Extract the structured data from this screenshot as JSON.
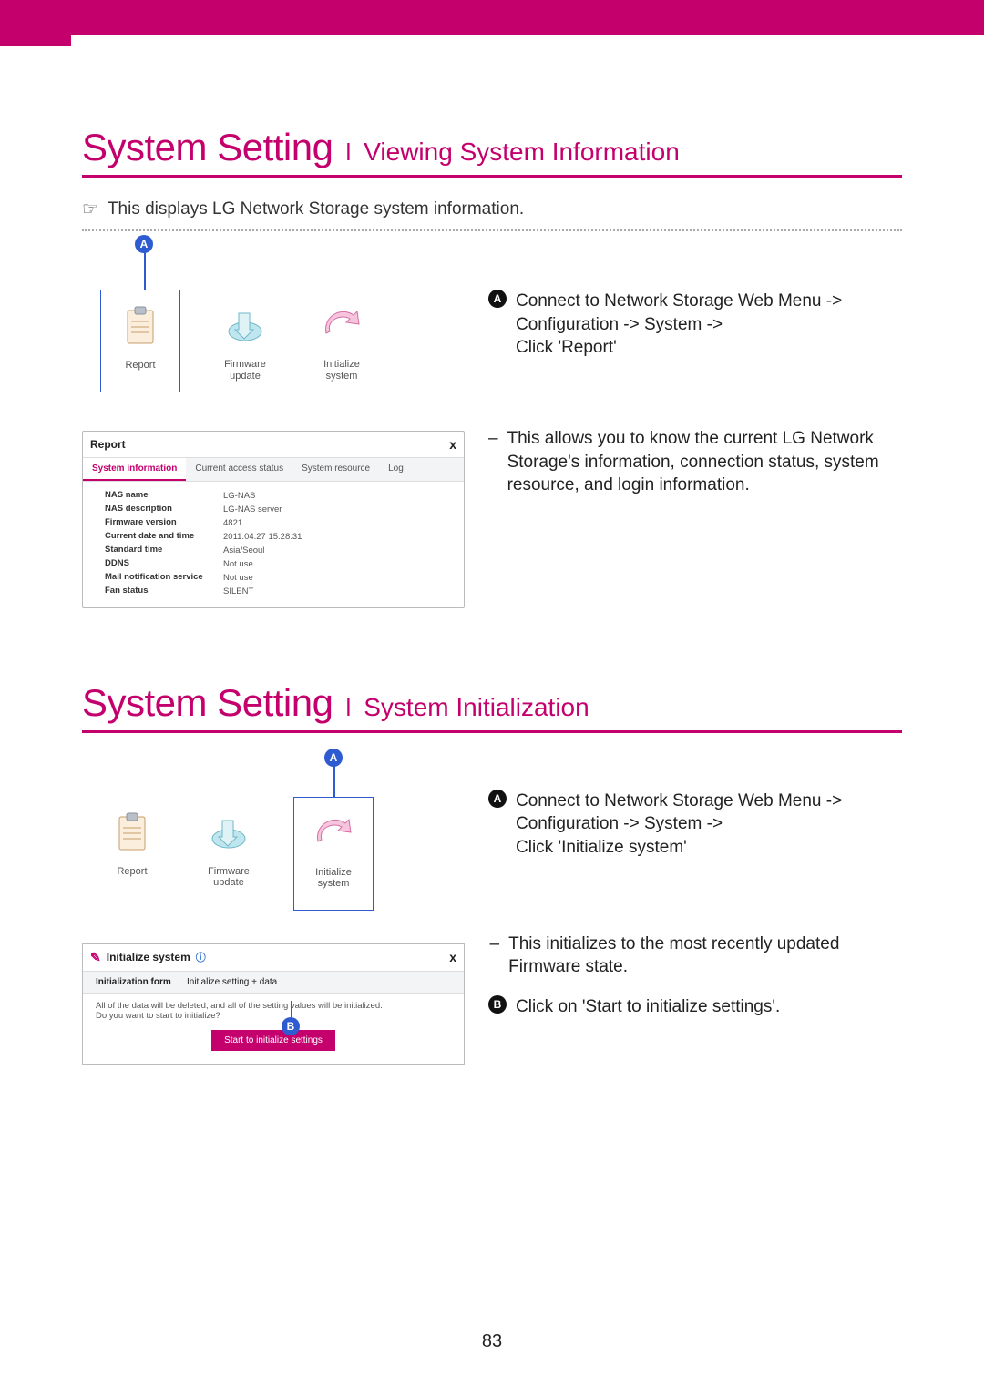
{
  "page_number": "83",
  "section1": {
    "title_main": "System Setting",
    "title_divider": "l",
    "title_sub": "Viewing System Information",
    "intro": "This displays LG Network Storage system information.",
    "tiles": {
      "report": "Report",
      "firmware": "Firmware\nupdate",
      "initialize": "Initialize\nsystem"
    },
    "highlight_badge": "A",
    "step_a_badge": "A",
    "step_a_text": "Connect to Network Storage Web Menu -> Configuration -> System ->\nClick 'Report'",
    "explain_text": "This allows you to know the current LG Network Storage's information, connection status, system resource, and login information.",
    "report_panel": {
      "title": "Report",
      "close": "x",
      "tabs": [
        "System information",
        "Current access status",
        "System resource",
        "Log"
      ],
      "active_tab_index": 0,
      "rows": [
        {
          "k": "NAS name",
          "v": "LG-NAS"
        },
        {
          "k": "NAS description",
          "v": "LG-NAS server"
        },
        {
          "k": "Firmware version",
          "v": "4821"
        },
        {
          "k": "Current date and time",
          "v": "2011.04.27 15:28:31"
        },
        {
          "k": "Standard time",
          "v": "Asia/Seoul"
        },
        {
          "k": "DDNS",
          "v": "Not use"
        },
        {
          "k": "Mail notification service",
          "v": "Not use"
        },
        {
          "k": "Fan status",
          "v": "SILENT"
        }
      ]
    }
  },
  "section2": {
    "title_main": "System Setting",
    "title_divider": "l",
    "title_sub": "System Initialization",
    "tiles": {
      "report": "Report",
      "firmware": "Firmware\nupdate",
      "initialize": "Initialize\nsystem"
    },
    "highlight_badge": "A",
    "step_a_badge": "A",
    "step_a_text": "Connect to Network Storage Web Menu -> Configuration -> System ->\nClick 'Initialize system'",
    "explain_text": "This initializes to the most recently updated Firmware state.",
    "step_b_badge": "B",
    "step_b_text": "Click on 'Start to initialize settings'.",
    "init_panel": {
      "title": "Initialize system",
      "close": "x",
      "form_label": "Initialization form",
      "form_value": "Initialize setting + data",
      "msg_line1": "All of the data will be deleted, and all of the setting values will be initialized.",
      "msg_line2": "Do you want to start to initialize?",
      "button": "Start to initialize settings",
      "button_badge": "B"
    }
  }
}
